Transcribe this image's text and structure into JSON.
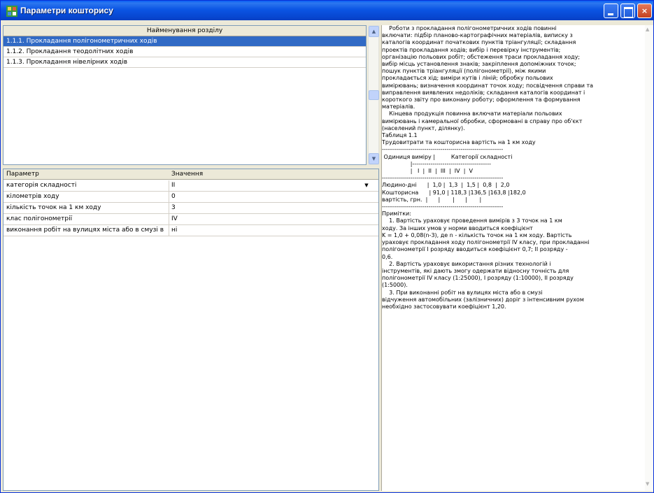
{
  "window": {
    "title": "Параметри кошторису",
    "icon": "app-icon",
    "buttons": {
      "minimize": "",
      "maximize": "",
      "close": "×"
    }
  },
  "sections": {
    "header": "Найменування розділу",
    "items": [
      "1.1.1. Прокладання полігонометричних ходів",
      "1.1.2. Прокладання теодолітних ходів",
      "1.1.3. Прокладання нівелірних ходів"
    ],
    "selected_index": 0
  },
  "params": {
    "headers": {
      "name": "Параметр",
      "value": "Значення"
    },
    "rows": [
      {
        "name": "категорія складності",
        "value": "II",
        "dropdown": true
      },
      {
        "name": "кілометрів ходу",
        "value": "0"
      },
      {
        "name": "кількість точок на 1 км ходу",
        "value": "3"
      },
      {
        "name": "клас полігонометрії",
        "value": "IV"
      },
      {
        "name": "виконання робіт на вулицях міста або в смузі від",
        "value": "ні"
      }
    ]
  },
  "description": {
    "lines": [
      "    Роботи з прокладання полігонометричних ходів повинні",
      "включати: підбір планово-картографічних матеріалів, виписку з",
      "каталогів координат початкових пунктів тріангуляції; складання",
      "проектів прокладання ходів; вибір і перевірку інструментів;",
      "організацію польових робіт; обстеження траси прокладання ходу;",
      "вибір місць установлення знаків; закріплення допоміжних точок;",
      "пошук пунктів тріангуляції (полігонометрії), між якими",
      "прокладається хід; виміри кутів і ліній; обробку польових",
      "вимірювань; визначення координат точок ходу; посвідчення справи та",
      "виправлення виявлених недоліків; складання каталогів координат і",
      "короткого звіту про виконану роботу; оформлення та формування",
      "матеріалів.",
      "    Кінцева продукція повинна включати матеріали польових",
      "вимірювань і камеральної обробки, сформовані в справу про об'єкт",
      "(населений пункт, ділянку).",
      "",
      "Таблиця 1.1",
      "Трудовитрати та кошторисна вартість на 1 км ходу",
      "------------------------------------------------------------",
      " Одиниця виміру |         Категорії складності",
      "                |---------------------------------------",
      "                |   I  |  II  |  III  |  IV  |  V",
      "------------------------------------------------------------",
      "Людино-дні      |  1,0 |  1,3  |  1,5 |  0,8  |  2,0",
      "Кошторисна      | 91,0 | 118,3 |136,5 |163,8 |182,0",
      "вартість, грн.  |      |       |      |       |",
      "------------------------------------------------------------",
      "",
      "Примітки:",
      "    1. Вартість ураховує проведення вимірів з 3 точок на 1 км",
      "ходу. За інших умов у норми вводиться коефіцієнт",
      "K = 1,0 + 0,08(n-3), де n - кількість точок на 1 км ходу. Вартість",
      "ураховує прокладання ходу полігонометрії IV класу, при прокладанні",
      "полігонометрії I розряду вводиться коефіцієнт 0,7; II розряду -",
      "0,6.",
      "    2. Вартість ураховує використання різних технологій і",
      "інструментів, які дають змогу одержати відносну точність для",
      "полігонометрії IV класу (1:25000), I розряду (1:10000), II розряду",
      "(1:5000).",
      "    3. При виконанні робіт на вулицях міста або в смузі",
      "відчуження автомобільних (залізничних) доріг з інтенсивним рухом",
      "необхідно застосовувати коефіцієнт 1,20."
    ]
  }
}
